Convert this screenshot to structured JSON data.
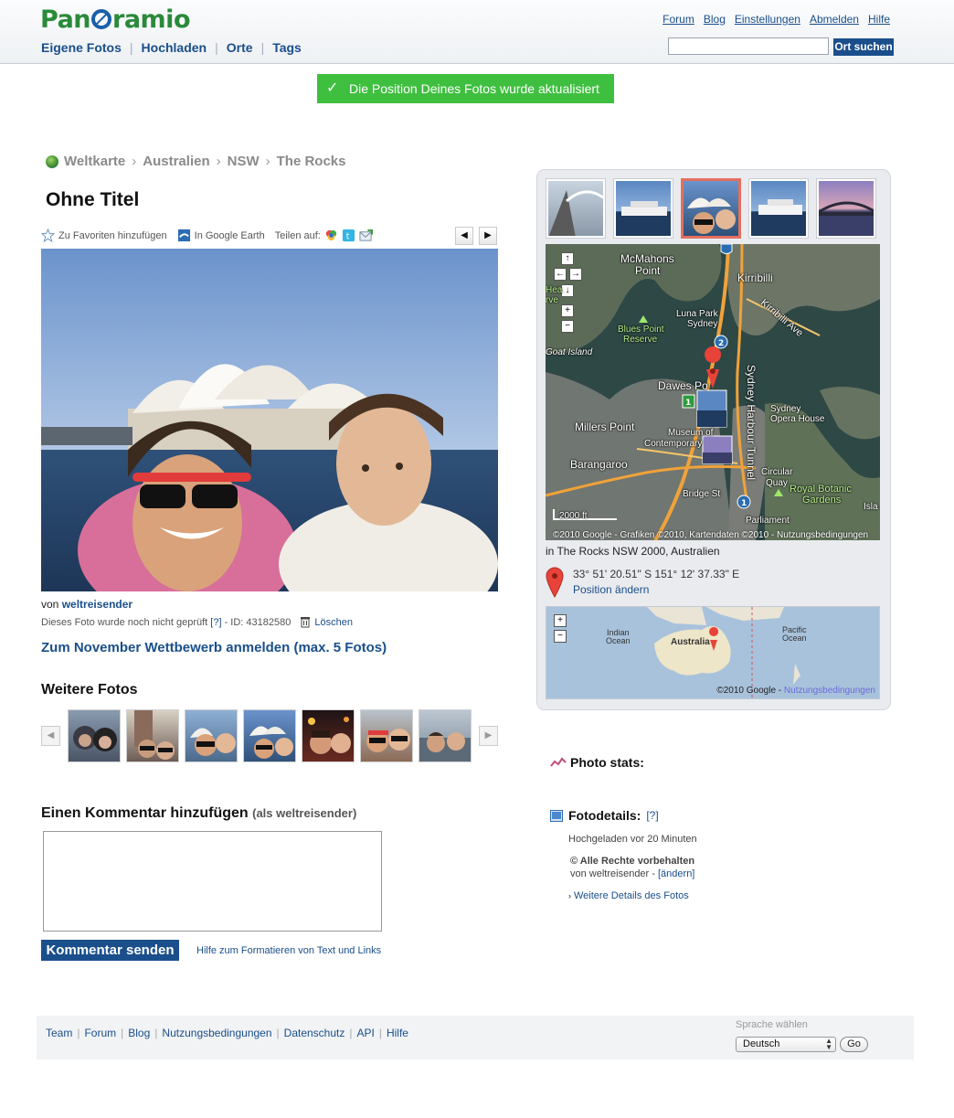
{
  "header": {
    "logo_left": "Pan",
    "logo_right": "ramio",
    "nav": [
      "Eigene Fotos",
      "Hochladen",
      "Orte",
      "Tags"
    ],
    "top_links": [
      "Forum",
      "Blog",
      "Einstellungen",
      "Abmelden",
      "Hilfe"
    ],
    "search_value": "",
    "search_button": "Ort suchen"
  },
  "notice": "Die Position Deines Fotos wurde aktualisiert",
  "breadcrumb": [
    "Weltkarte",
    "Australien",
    "NSW",
    "The Rocks"
  ],
  "photo": {
    "title": "Ohne Titel",
    "actions": {
      "favorite": "Zu Favoriten hinzufügen",
      "earth": "In Google Earth",
      "share": "Teilen auf:"
    },
    "by_prefix": "von",
    "author": "weltreisender",
    "not_reviewed": "Dieses Foto wurde noch nicht geprüft",
    "help": "[?]",
    "id_text": "- ID: 43182580",
    "delete": "Löschen",
    "contest": "Zum November Wettbewerb anmelden (max. 5 Fotos)"
  },
  "more_photos": {
    "title": "Weitere Fotos"
  },
  "comment": {
    "title": "Einen Kommentar hinzufügen",
    "subtitle": "(als weltreisender)",
    "value": "",
    "send": "Kommentar senden",
    "format_help": "Hilfe zum Formatieren von Text und Links"
  },
  "map": {
    "labels": {
      "mcmahons": "McMahons",
      "point": "Point",
      "kirribilli": "Kirribilli",
      "kirribilli_ave": "Kirribilli Ave",
      "luna_park": "Luna Park",
      "sydney": "Sydney",
      "blues_point": "Blues Point",
      "reserve": "Reserve",
      "goat_island": "Goat Island",
      "dawes_point": "Dawes Po",
      "harbour_tunnel": "Sydney Harbour Tunnel",
      "sydney_opera": "Sydney",
      "opera_house": "Opera House",
      "millers_point": "Millers Point",
      "museum": "Museum of",
      "contemporary": "Contemporary",
      "barangaroo": "Barangaroo",
      "circular": "Circular",
      "quay": "Quay",
      "royal_botanic": "Royal Botanic",
      "gardens": "Gardens",
      "bridge_st": "Bridge St",
      "parliament": "Parliament",
      "hea": "Hea",
      "rve": "rve",
      "isla": "Isla"
    },
    "scale": "2000 ft",
    "copyright": "©2010 Google - Grafiken ©2010, Kartendaten ©2010 - Nutzungsbedingungen",
    "location": "in The Rocks NSW 2000, Australien",
    "coords": "33° 51' 20.51\" S   151° 12' 37.33\" E",
    "change_position": "Position ändern"
  },
  "minimap": {
    "indian": "Indian",
    "indian2": "Ocean",
    "australia": "Australia",
    "pacific": "Pacific",
    "pacific2": "Ocean",
    "copyright": "©2010 Google - ",
    "terms": "Nutzungsbedingungen"
  },
  "stats": {
    "title": "Photo stats:"
  },
  "details": {
    "title": "Fotodetails:",
    "help": "[?]",
    "uploaded": "Hochgeladen vor 20 Minuten",
    "rights": "© Alle Rechte vorbehalten",
    "rights_by": "von weltreisender - ",
    "change": "[ändern]",
    "more": "Weitere Details des Fotos"
  },
  "footer": {
    "links": [
      "Team",
      "Forum",
      "Blog",
      "Nutzungsbedingungen",
      "Datenschutz",
      "API",
      "Hilfe"
    ],
    "language_label": "Sprache wählen",
    "language_value": "Deutsch",
    "go": "Go"
  },
  "colors": {
    "brand_green": "#2a8a3a",
    "link_blue": "#1a4f8b",
    "button_blue": "#1b4f8c",
    "notice_green": "#3fbf3f",
    "active_thumb": "#e3705f"
  }
}
